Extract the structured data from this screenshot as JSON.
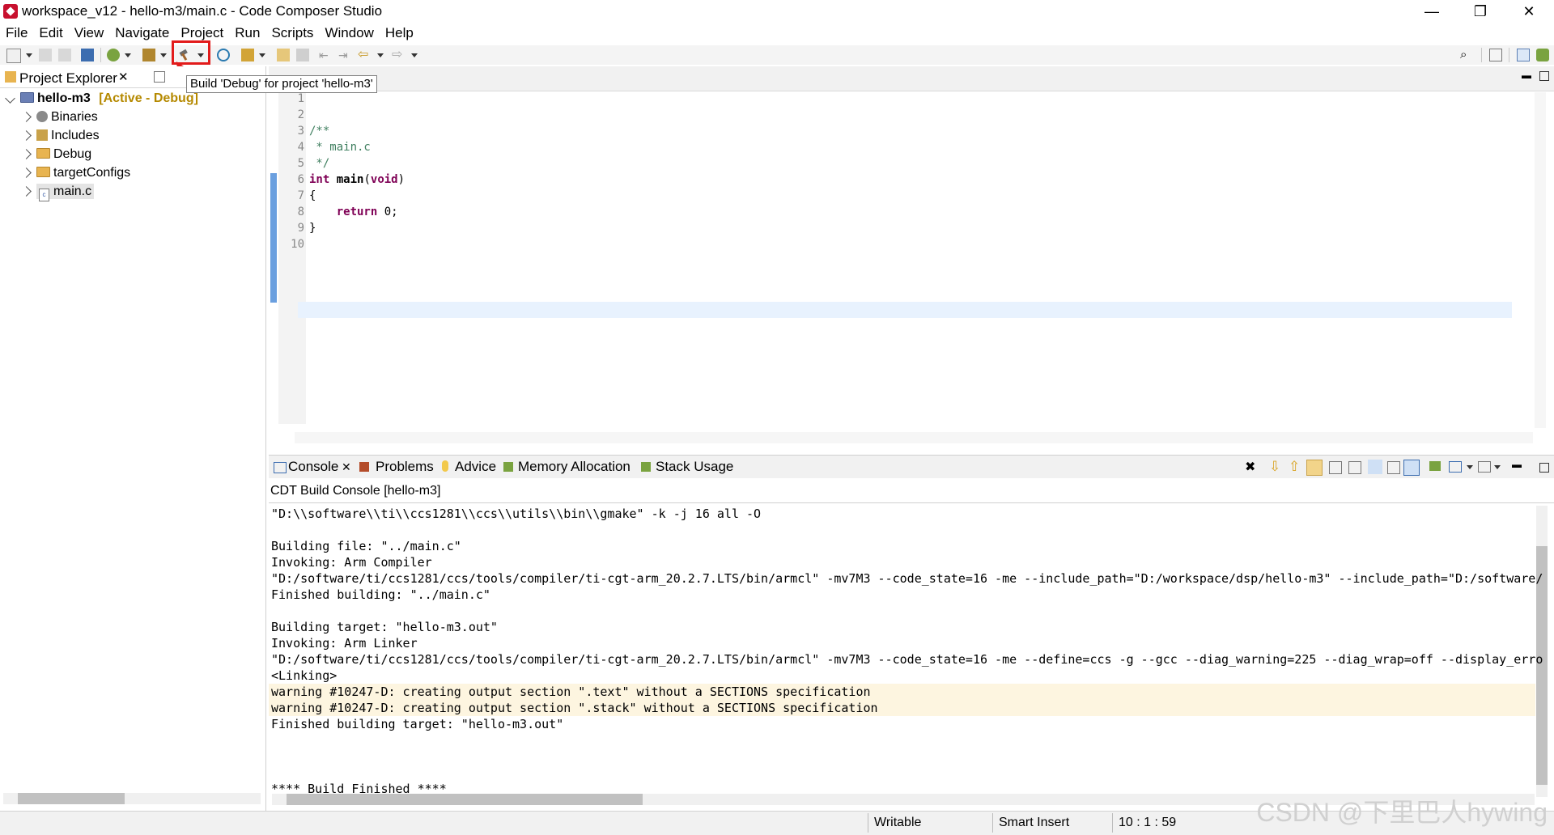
{
  "window": {
    "title": "workspace_v12 - hello-m3/main.c - Code Composer Studio",
    "controls": [
      "—",
      "❐",
      "✕"
    ]
  },
  "menu": [
    "File",
    "Edit",
    "View",
    "Navigate",
    "Project",
    "Run",
    "Scripts",
    "Window",
    "Help"
  ],
  "tooltip": "Build 'Debug' for project 'hello-m3'",
  "project_explorer": {
    "tab_label": "Project Explorer",
    "project": {
      "name": "hello-m3",
      "tag": "[Active - Debug]"
    },
    "items": [
      "Binaries",
      "Includes",
      "Debug",
      "targetConfigs",
      "main.c"
    ]
  },
  "editor": {
    "line_numbers": [
      "1",
      "2",
      "3",
      "4",
      "5",
      "6",
      "7",
      "8",
      "9",
      "10"
    ],
    "lines": [
      "",
      "",
      "/**",
      " * main.c",
      " */",
      "int main(void)",
      "{",
      "    return 0;",
      "}",
      ""
    ]
  },
  "console": {
    "tabs": [
      "Console",
      "Problems",
      "Advice",
      "Memory Allocation",
      "Stack Usage"
    ],
    "title": "CDT Build Console [hello-m3]",
    "lines": [
      "\"D:\\\\software\\\\ti\\\\ccs1281\\\\ccs\\\\utils\\\\bin\\\\gmake\" -k -j 16 all -O",
      "",
      "Building file: \"../main.c\"",
      "Invoking: Arm Compiler",
      "\"D:/software/ti/ccs1281/ccs/tools/compiler/ti-cgt-arm_20.2.7.LTS/bin/armcl\" -mv7M3 --code_state=16 -me --include_path=\"D:/workspace/dsp/hello-m3\" --include_path=\"D:/software/",
      "Finished building: \"../main.c\"",
      "",
      "Building target: \"hello-m3.out\"",
      "Invoking: Arm Linker",
      "\"D:/software/ti/ccs1281/ccs/tools/compiler/ti-cgt-arm_20.2.7.LTS/bin/armcl\" -mv7M3 --code_state=16 -me --define=ccs -g --gcc --diag_warning=225 --diag_wrap=off --display_erro",
      "<Linking>",
      "warning #10247-D: creating output section \".text\" without a SECTIONS specification",
      "warning #10247-D: creating output section \".stack\" without a SECTIONS specification",
      "Finished building target: \"hello-m3.out\"",
      "",
      "",
      "",
      "**** Build Finished ****"
    ]
  },
  "status": {
    "mode": "Writable",
    "insert": "Smart Insert",
    "position": "10 : 1 : 59"
  },
  "watermark": "CSDN @下里巴人hywing",
  "colors": {
    "highlight": "#e21b1b",
    "warning_bg": "#fdf5e0",
    "current_line": "#e8f2fe"
  }
}
